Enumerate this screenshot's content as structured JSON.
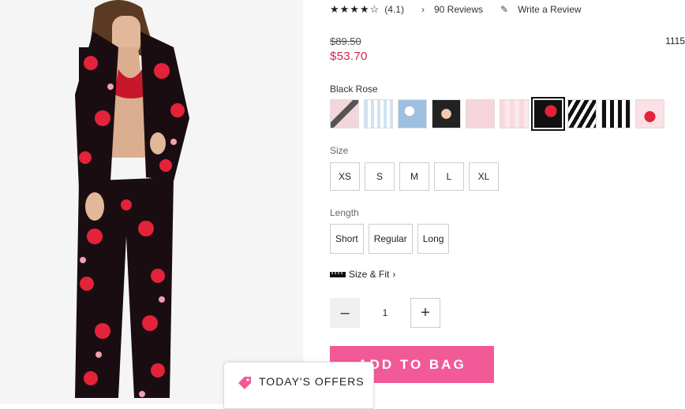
{
  "product": {
    "rating_text": "(4.1)",
    "reviews_label": "90 Reviews",
    "write_review_label": "Write a Review",
    "sku_partial": "1115",
    "original_price": "$89.50",
    "sale_price": "$53.70",
    "selected_color": "Black Rose"
  },
  "size": {
    "label": "Size",
    "options": [
      "XS",
      "S",
      "M",
      "L",
      "XL"
    ]
  },
  "length": {
    "label": "Length",
    "options": [
      "Short",
      "Regular",
      "Long"
    ]
  },
  "size_fit_label": "Size & Fit",
  "quantity": {
    "value": "1"
  },
  "add_to_bag_label": "ADD TO BAG",
  "offers_label": "TODAY'S OFFERS",
  "colors": {
    "sale": "#d7234d",
    "cta": "#f25a97"
  },
  "swatch_count": 10,
  "selected_swatch_index": 6
}
